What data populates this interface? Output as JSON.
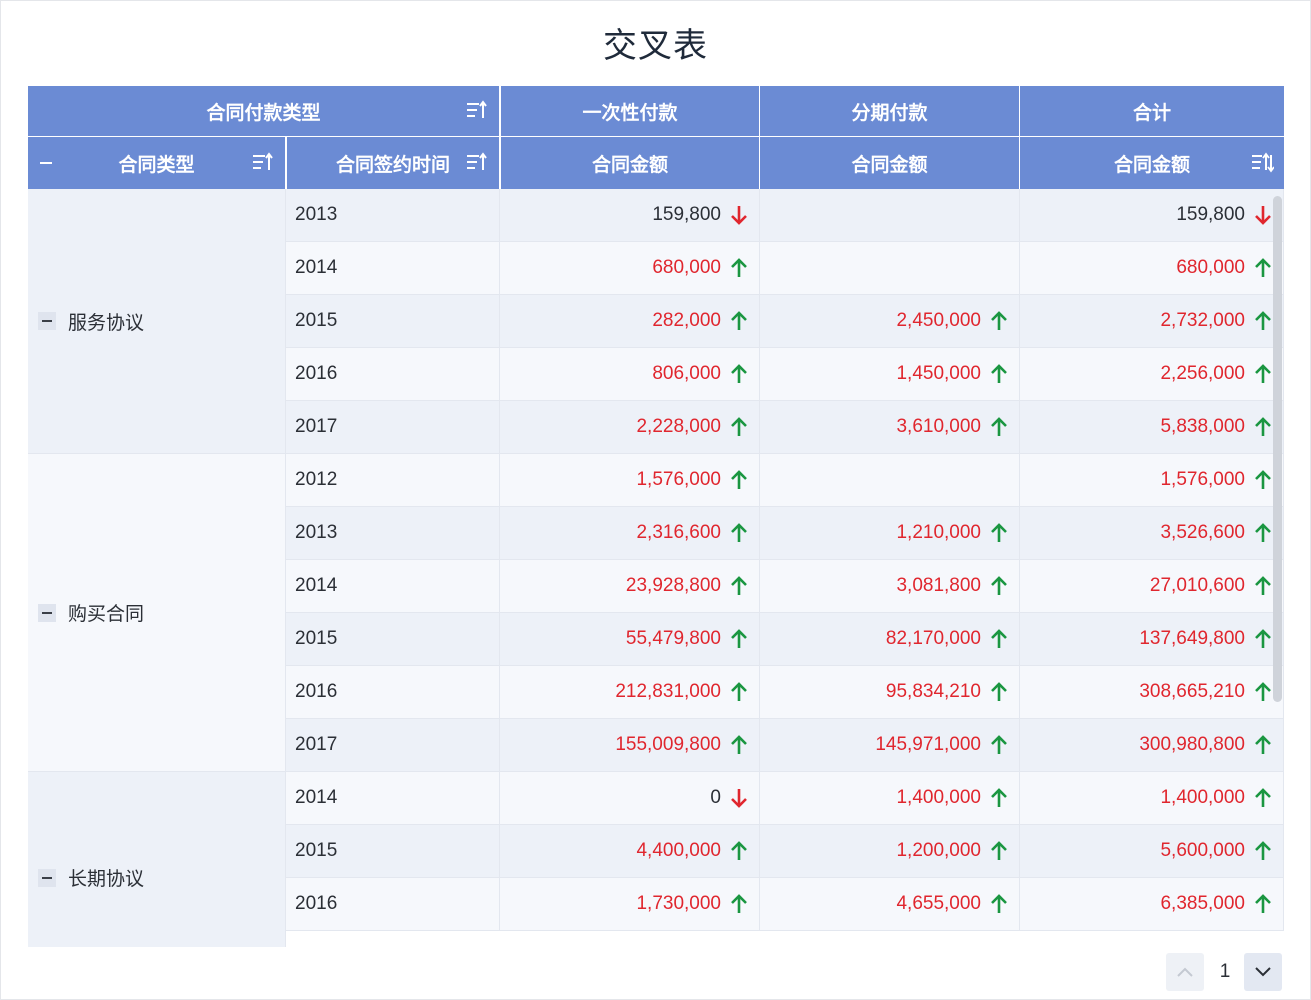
{
  "title": "交叉表",
  "colors": {
    "header_bg": "#6b8bd4",
    "value_up": "#e0262e",
    "arrow_up": "#1a9641",
    "arrow_down": "#e0262e",
    "row_even": "#edf1f8",
    "row_odd": "#f6f8fc"
  },
  "header": {
    "pay_type_label": "合同付款类型",
    "col_onetime": "一次性付款",
    "col_install": "分期付款",
    "col_total": "合计",
    "contract_type_label": "合同类型",
    "sign_time_label": "合同签约时间",
    "amount_label": "合同金额",
    "icons": {
      "sort_asc": "sort-ascending-icon",
      "sort_both": "sort-toggle-icon",
      "collapse": "collapse-minus-icon"
    }
  },
  "groups": [
    {
      "label": "服务协议",
      "rows": 5
    },
    {
      "label": "购买合同",
      "rows": 6
    },
    {
      "label": "长期协议",
      "rows": 4
    }
  ],
  "rows": [
    {
      "year": "2013",
      "onetime": {
        "v": "159,800",
        "dir": "down"
      },
      "install": null,
      "total": {
        "v": "159,800",
        "dir": "down"
      }
    },
    {
      "year": "2014",
      "onetime": {
        "v": "680,000",
        "dir": "up"
      },
      "install": null,
      "total": {
        "v": "680,000",
        "dir": "up"
      }
    },
    {
      "year": "2015",
      "onetime": {
        "v": "282,000",
        "dir": "up"
      },
      "install": {
        "v": "2,450,000",
        "dir": "up"
      },
      "total": {
        "v": "2,732,000",
        "dir": "up"
      }
    },
    {
      "year": "2016",
      "onetime": {
        "v": "806,000",
        "dir": "up"
      },
      "install": {
        "v": "1,450,000",
        "dir": "up"
      },
      "total": {
        "v": "2,256,000",
        "dir": "up"
      }
    },
    {
      "year": "2017",
      "onetime": {
        "v": "2,228,000",
        "dir": "up"
      },
      "install": {
        "v": "3,610,000",
        "dir": "up"
      },
      "total": {
        "v": "5,838,000",
        "dir": "up"
      }
    },
    {
      "year": "2012",
      "onetime": {
        "v": "1,576,000",
        "dir": "up"
      },
      "install": null,
      "total": {
        "v": "1,576,000",
        "dir": "up"
      }
    },
    {
      "year": "2013",
      "onetime": {
        "v": "2,316,600",
        "dir": "up"
      },
      "install": {
        "v": "1,210,000",
        "dir": "up"
      },
      "total": {
        "v": "3,526,600",
        "dir": "up"
      }
    },
    {
      "year": "2014",
      "onetime": {
        "v": "23,928,800",
        "dir": "up"
      },
      "install": {
        "v": "3,081,800",
        "dir": "up"
      },
      "total": {
        "v": "27,010,600",
        "dir": "up"
      }
    },
    {
      "year": "2015",
      "onetime": {
        "v": "55,479,800",
        "dir": "up"
      },
      "install": {
        "v": "82,170,000",
        "dir": "up"
      },
      "total": {
        "v": "137,649,800",
        "dir": "up"
      }
    },
    {
      "year": "2016",
      "onetime": {
        "v": "212,831,000",
        "dir": "up"
      },
      "install": {
        "v": "95,834,210",
        "dir": "up"
      },
      "total": {
        "v": "308,665,210",
        "dir": "up"
      }
    },
    {
      "year": "2017",
      "onetime": {
        "v": "155,009,800",
        "dir": "up"
      },
      "install": {
        "v": "145,971,000",
        "dir": "up"
      },
      "total": {
        "v": "300,980,800",
        "dir": "up"
      }
    },
    {
      "year": "2014",
      "onetime": {
        "v": "0",
        "dir": "down"
      },
      "install": {
        "v": "1,400,000",
        "dir": "up"
      },
      "total": {
        "v": "1,400,000",
        "dir": "up"
      }
    },
    {
      "year": "2015",
      "onetime": {
        "v": "4,400,000",
        "dir": "up"
      },
      "install": {
        "v": "1,200,000",
        "dir": "up"
      },
      "total": {
        "v": "5,600,000",
        "dir": "up"
      }
    },
    {
      "year": "2016",
      "onetime": {
        "v": "1,730,000",
        "dir": "up"
      },
      "install": {
        "v": "4,655,000",
        "dir": "up"
      },
      "total": {
        "v": "6,385,000",
        "dir": "up"
      }
    }
  ],
  "pager": {
    "page": "1",
    "prev_icon": "chevron-up-icon",
    "next_icon": "chevron-down-icon"
  }
}
